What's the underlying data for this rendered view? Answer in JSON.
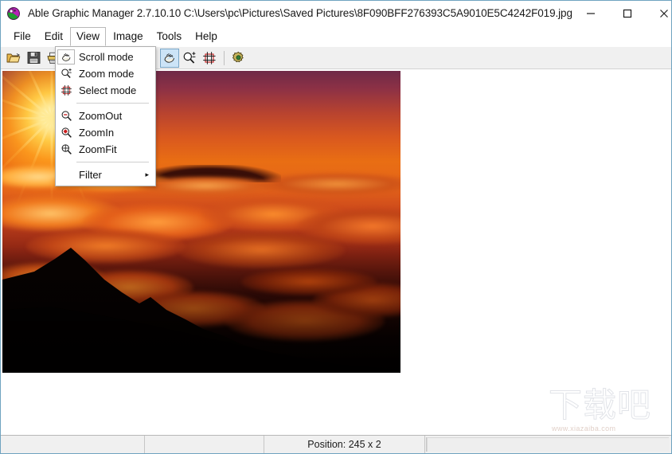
{
  "window": {
    "title": "Able Graphic Manager 2.7.10.10 C:\\Users\\pc\\Pictures\\Saved Pictures\\8F090BFF276393C5A9010E5C4242F019.jpg",
    "app_icon": "palette-icon",
    "controls": {
      "minimize": "–",
      "maximize": "☐",
      "close": "✕"
    }
  },
  "menubar": {
    "items": [
      {
        "label": "File",
        "open": false
      },
      {
        "label": "Edit",
        "open": false
      },
      {
        "label": "View",
        "open": true
      },
      {
        "label": "Image",
        "open": false
      },
      {
        "label": "Tools",
        "open": false
      },
      {
        "label": "Help",
        "open": false
      }
    ]
  },
  "toolbar": {
    "buttons": [
      {
        "name": "open-file-button",
        "icon": "open-folder-icon",
        "active": false
      },
      {
        "name": "save-file-button",
        "icon": "floppy-save-icon",
        "active": false
      },
      {
        "name": "print-button",
        "icon": "printer-icon",
        "active": false
      },
      {
        "name": "zoom-out-button",
        "icon": "zoom-out-icon",
        "active": false
      },
      {
        "name": "zoom-fit-button",
        "icon": "zoom-fit-icon",
        "active": false
      },
      {
        "name": "filter-button",
        "icon": "funnel-filter-icon",
        "active": false
      },
      {
        "name": "scroll-mode-button",
        "icon": "hand-scroll-icon",
        "active": true
      },
      {
        "name": "zoom-mode-button",
        "icon": "zoom-plusminus-icon",
        "active": false
      },
      {
        "name": "select-mode-button",
        "icon": "crop-select-icon",
        "active": false
      },
      {
        "name": "settings-button",
        "icon": "gear-icon",
        "active": false
      }
    ],
    "dropdown_caret": "▾"
  },
  "view_menu": {
    "items": [
      {
        "label": "Scroll mode",
        "icon": "hand-scroll-icon",
        "selected": true,
        "submenu": false
      },
      {
        "label": "Zoom mode",
        "icon": "zoom-plusminus-icon",
        "selected": false,
        "submenu": false
      },
      {
        "label": "Select mode",
        "icon": "crop-select-icon",
        "selected": false,
        "submenu": false
      },
      {
        "separator": true
      },
      {
        "label": "ZoomOut",
        "icon": "zoom-out-icon",
        "selected": false,
        "submenu": false
      },
      {
        "label": "ZoomIn",
        "icon": "zoom-in-icon",
        "selected": false,
        "submenu": false
      },
      {
        "label": "ZoomFit",
        "icon": "zoom-fit-icon",
        "selected": false,
        "submenu": false
      },
      {
        "separator": true
      },
      {
        "label": "Filter",
        "icon": "none",
        "selected": false,
        "submenu": true,
        "submenu_arrow": "▸"
      }
    ]
  },
  "statusbar": {
    "cell1": "",
    "cell2": "",
    "position": "Position: 245 x 2",
    "cell4": ""
  },
  "watermark": {
    "logo_text": "下载吧",
    "url_text": "www.xiazaiba.com"
  },
  "colors": {
    "accent": "#cce4f7",
    "accent_border": "#7aa7c7",
    "window_border": "#6fa3c0",
    "toolbar_bg": "#f0f0f0",
    "statusbar_bg": "#f0f0f0"
  },
  "photo": {
    "alt": "sunset-above-clouds-photo"
  }
}
